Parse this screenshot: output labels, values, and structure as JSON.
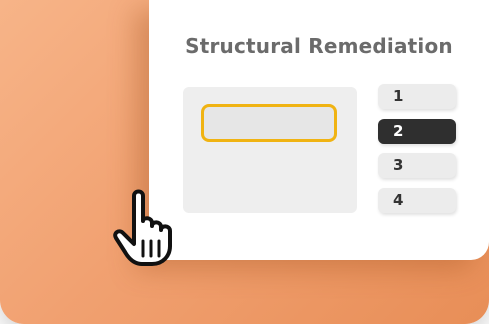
{
  "card": {
    "title": "Structural Remediation"
  },
  "options": [
    {
      "label": "1",
      "selected": false
    },
    {
      "label": "2",
      "selected": true
    },
    {
      "label": "3",
      "selected": false
    },
    {
      "label": "4",
      "selected": false
    }
  ],
  "colors": {
    "backdrop": "#f1a171",
    "selected_option": "#2f2f2f",
    "input_focus_border": "#f0b312"
  },
  "icons": {
    "cursor": "pointing-hand-icon"
  }
}
